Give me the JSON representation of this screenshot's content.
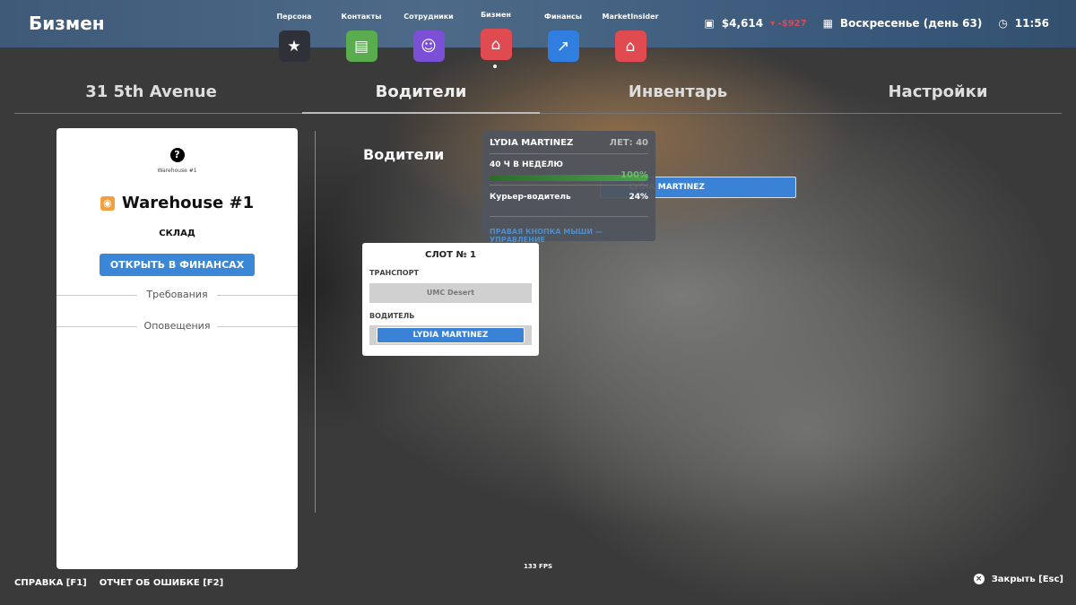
{
  "header": {
    "title": "Бизмен",
    "apps": [
      {
        "label": "Персона",
        "icon": "star-icon",
        "color": "#2e3238"
      },
      {
        "label": "Контакты",
        "icon": "chat-icon",
        "color": "#5aad4e"
      },
      {
        "label": "Сотрудники",
        "icon": "badge-icon",
        "color": "#7b4fd6"
      },
      {
        "label": "Бизмен",
        "icon": "store-icon",
        "color": "#e04b52",
        "active": true
      },
      {
        "label": "Финансы",
        "icon": "chart-icon",
        "color": "#2f7ee0"
      },
      {
        "label": "MarketInsider",
        "icon": "store-icon",
        "color": "#e04b52"
      }
    ],
    "money": "$4,614",
    "money_change": "-$927",
    "date": "Воскресенье (день 63)",
    "time": "11:56"
  },
  "tabs": [
    "31 5th Avenue",
    "Водители",
    "Инвентарь",
    "Настройки"
  ],
  "card": {
    "caption": "Warehouse #1",
    "title": "Warehouse #1",
    "type": "СКЛАД",
    "button": "ОТКРЫТЬ В ФИНАНСАХ",
    "sections": [
      "Требования",
      "Оповещения"
    ]
  },
  "main": {
    "heading": "Водители",
    "slot": {
      "title": "СЛОТ № 1",
      "vehicle_label": "ТРАНСПОРТ",
      "vehicle": "UMC Desert",
      "driver_label": "ВОДИТЕЛЬ",
      "driver": "LYDIA MARTINEZ"
    },
    "dragged": "LYDIA MARTINEZ",
    "tooltip": {
      "name": "LYDIA MARTINEZ",
      "age": "ЛЕТ: 40",
      "hours": "40 Ч В НЕДЕЛЮ",
      "progress": 100,
      "progress_label": "100%",
      "skill": "Курьер-водитель",
      "skill_value": "24%",
      "hint": "ПРАВАЯ КНОПКА МЫШИ — УПРАВЛЕНИЕ"
    }
  },
  "fps": "133 FPS",
  "footer": {
    "help": "СПРАВКА [F1]",
    "bug": "ОТЧЕТ ОБ ОШИБКЕ [F2]",
    "close": "Закрыть [Esc]"
  }
}
